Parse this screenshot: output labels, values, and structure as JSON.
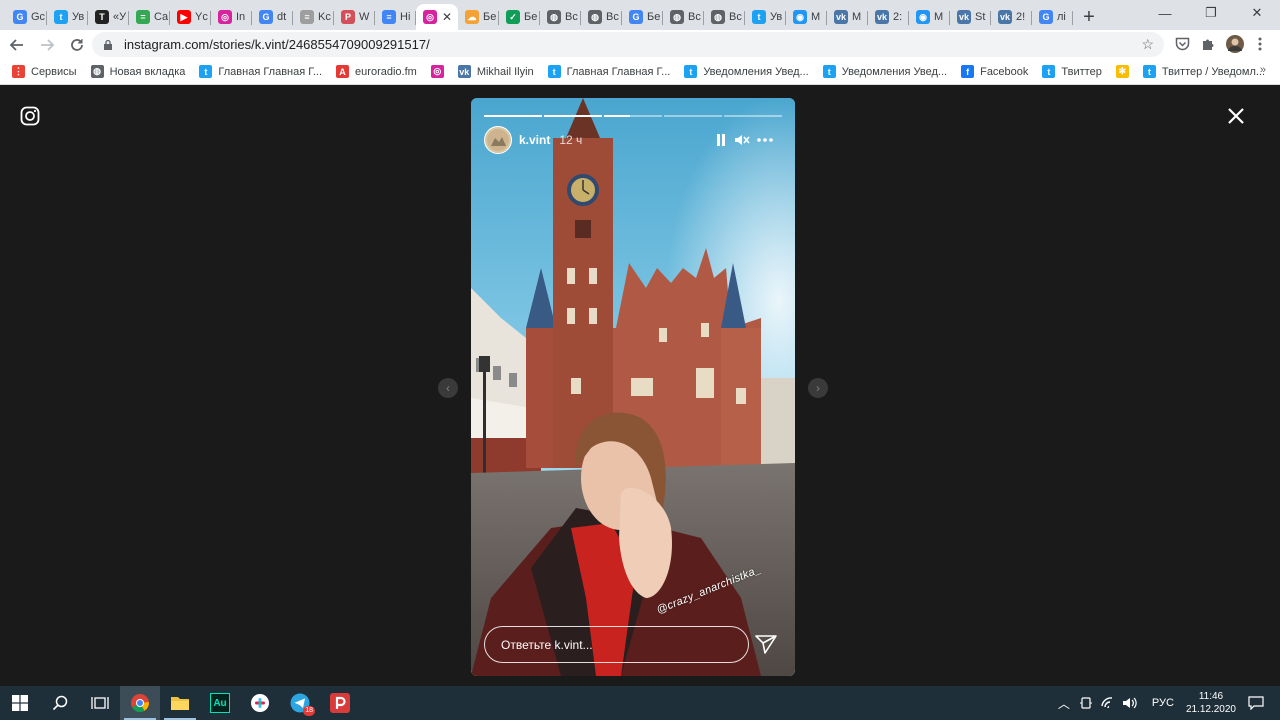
{
  "tabs": [
    {
      "label": "Gc",
      "icon": "google-icon",
      "color": "#4285f4",
      "glyph": "G"
    },
    {
      "label": "Ув",
      "icon": "twitter-icon",
      "color": "#1da1f2",
      "glyph": "t"
    },
    {
      "label": "«У",
      "icon": "t-news-icon",
      "color": "#222222",
      "glyph": "T"
    },
    {
      "label": "Ca",
      "icon": "calendar-icon",
      "color": "#34a853",
      "glyph": "="
    },
    {
      "label": "Yc",
      "icon": "youtube-icon",
      "color": "#ff0000",
      "glyph": "▶"
    },
    {
      "label": "In",
      "icon": "instagram-icon",
      "color": "#d6249f",
      "glyph": "◎"
    },
    {
      "label": "dt",
      "icon": "google-icon",
      "color": "#4285f4",
      "glyph": "G"
    },
    {
      "label": "Kc",
      "icon": "doc-icon",
      "color": "#9e9e9e",
      "glyph": "≡"
    },
    {
      "label": "W",
      "icon": "pocket-icon",
      "color": "#d3505a",
      "glyph": "P"
    },
    {
      "label": "Hi",
      "icon": "docs-icon",
      "color": "#4285f4",
      "glyph": "≡"
    },
    {
      "label": "",
      "icon": "instagram-icon",
      "color": "#d6249f",
      "glyph": "◎",
      "active": true
    },
    {
      "label": "Бе",
      "icon": "cloud-icon",
      "color": "#f4a236",
      "glyph": "☁"
    },
    {
      "label": "Бе",
      "icon": "check-icon",
      "color": "#0f9d58",
      "glyph": "✓"
    },
    {
      "label": "Вс",
      "icon": "globe-icon",
      "color": "#5f6368",
      "glyph": "◍"
    },
    {
      "label": "Вс",
      "icon": "globe-icon",
      "color": "#5f6368",
      "glyph": "◍"
    },
    {
      "label": "Бе",
      "icon": "google-icon",
      "color": "#4285f4",
      "glyph": "G"
    },
    {
      "label": "Вс",
      "icon": "globe-icon",
      "color": "#5f6368",
      "glyph": "◍"
    },
    {
      "label": "Вс",
      "icon": "globe-icon",
      "color": "#5f6368",
      "glyph": "◍"
    },
    {
      "label": "Ув",
      "icon": "twitter-icon",
      "color": "#1da1f2",
      "glyph": "t"
    },
    {
      "label": "М",
      "icon": "messenger-icon",
      "color": "#2196f3",
      "glyph": "◉"
    },
    {
      "label": "М",
      "icon": "vk-icon",
      "color": "#4a76a8",
      "glyph": "vk"
    },
    {
      "label": "2:",
      "icon": "vk-icon",
      "color": "#4a76a8",
      "glyph": "vk"
    },
    {
      "label": "М",
      "icon": "messenger-icon",
      "color": "#2196f3",
      "glyph": "◉"
    },
    {
      "label": "St",
      "icon": "vk-icon",
      "color": "#4a76a8",
      "glyph": "vk"
    },
    {
      "label": "2!",
      "icon": "vk-icon",
      "color": "#4a76a8",
      "glyph": "vk"
    },
    {
      "label": "лі",
      "icon": "google-icon",
      "color": "#4285f4",
      "glyph": "G"
    }
  ],
  "tab_close": "✕",
  "new_tab": "+",
  "window": {
    "minimize": "—",
    "maximize": "❐",
    "close": "✕"
  },
  "address": {
    "url": "instagram.com/stories/k.vint/2468554709009291517/"
  },
  "bookmarks": [
    {
      "label": "Сервисы",
      "icon": "apps-icon",
      "color": "#ea4335",
      "glyph": "⋮"
    },
    {
      "label": "Новая вкладка",
      "icon": "globe-icon",
      "color": "#5f6368",
      "glyph": "◍"
    },
    {
      "label": "Главная Главная Г...",
      "icon": "twitter-icon",
      "color": "#1da1f2",
      "glyph": "t"
    },
    {
      "label": "euroradio.fm",
      "icon": "euroradio-icon",
      "color": "#e53935",
      "glyph": "A"
    },
    {
      "label": "",
      "icon": "instagram-icon",
      "color": "#d6249f",
      "glyph": "◎"
    },
    {
      "label": "Mikhail Ilyin",
      "icon": "vk-icon",
      "color": "#4a76a8",
      "glyph": "vk"
    },
    {
      "label": "Главная Главная Г...",
      "icon": "twitter-icon",
      "color": "#1da1f2",
      "glyph": "t"
    },
    {
      "label": "Уведомления Увед...",
      "icon": "twitter-icon",
      "color": "#1da1f2",
      "glyph": "t"
    },
    {
      "label": "Уведомления Увед...",
      "icon": "twitter-icon",
      "color": "#1da1f2",
      "glyph": "t"
    },
    {
      "label": "Facebook",
      "icon": "facebook-icon",
      "color": "#1877f2",
      "glyph": "f"
    },
    {
      "label": "Твиттер",
      "icon": "twitter-icon",
      "color": "#1da1f2",
      "glyph": "t"
    },
    {
      "label": "",
      "icon": "pinwheel-icon",
      "color": "#fbbc05",
      "glyph": "✻"
    },
    {
      "label": "Твиттер / Уведомл...",
      "icon": "twitter-icon",
      "color": "#1da1f2",
      "glyph": "t"
    }
  ],
  "bookmarks_more": "»",
  "story": {
    "username": "k.vint",
    "time": "12 ч",
    "progress": [
      1,
      1,
      0.45,
      0,
      0
    ],
    "sticker": "@crazy_anarchistka_",
    "reply_placeholder": "Ответьте k.vint..."
  },
  "taskbar": {
    "apps": [
      {
        "name": "windows-start-icon"
      },
      {
        "name": "search-icon"
      },
      {
        "name": "task-view-icon"
      },
      {
        "name": "chrome-icon",
        "active": true
      },
      {
        "name": "file-explorer-icon",
        "open": true
      },
      {
        "name": "audition-icon"
      },
      {
        "name": "slack-icon"
      },
      {
        "name": "telegram-icon",
        "badge": "18"
      },
      {
        "name": "pocket-casts-icon"
      }
    ],
    "audition_label": "Au",
    "language": "РУС",
    "time": "11:46",
    "date": "21.12.2020"
  }
}
